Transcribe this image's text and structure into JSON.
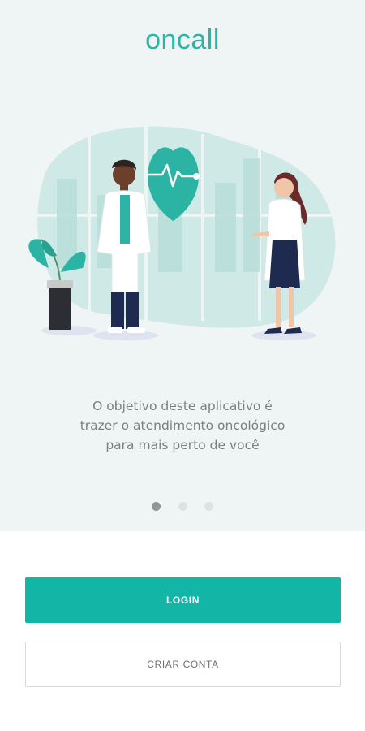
{
  "app": {
    "logo_text": "oncall"
  },
  "onboarding": {
    "message_lines": [
      "O objetivo deste aplicativo é",
      "trazer o atendimento oncológico",
      "para mais perto de você"
    ],
    "pagination": {
      "total": 3,
      "current": 1
    }
  },
  "actions": {
    "login_label": "LOGIN",
    "create_account_label": "CRIAR CONTA"
  },
  "colors": {
    "accent": "#12b5a6",
    "background": "#eff4f4",
    "text_muted": "#7a7f82"
  },
  "icons": [
    "heart-pulse-icon",
    "doctor-male-figure",
    "doctor-female-figure",
    "potted-plant"
  ]
}
